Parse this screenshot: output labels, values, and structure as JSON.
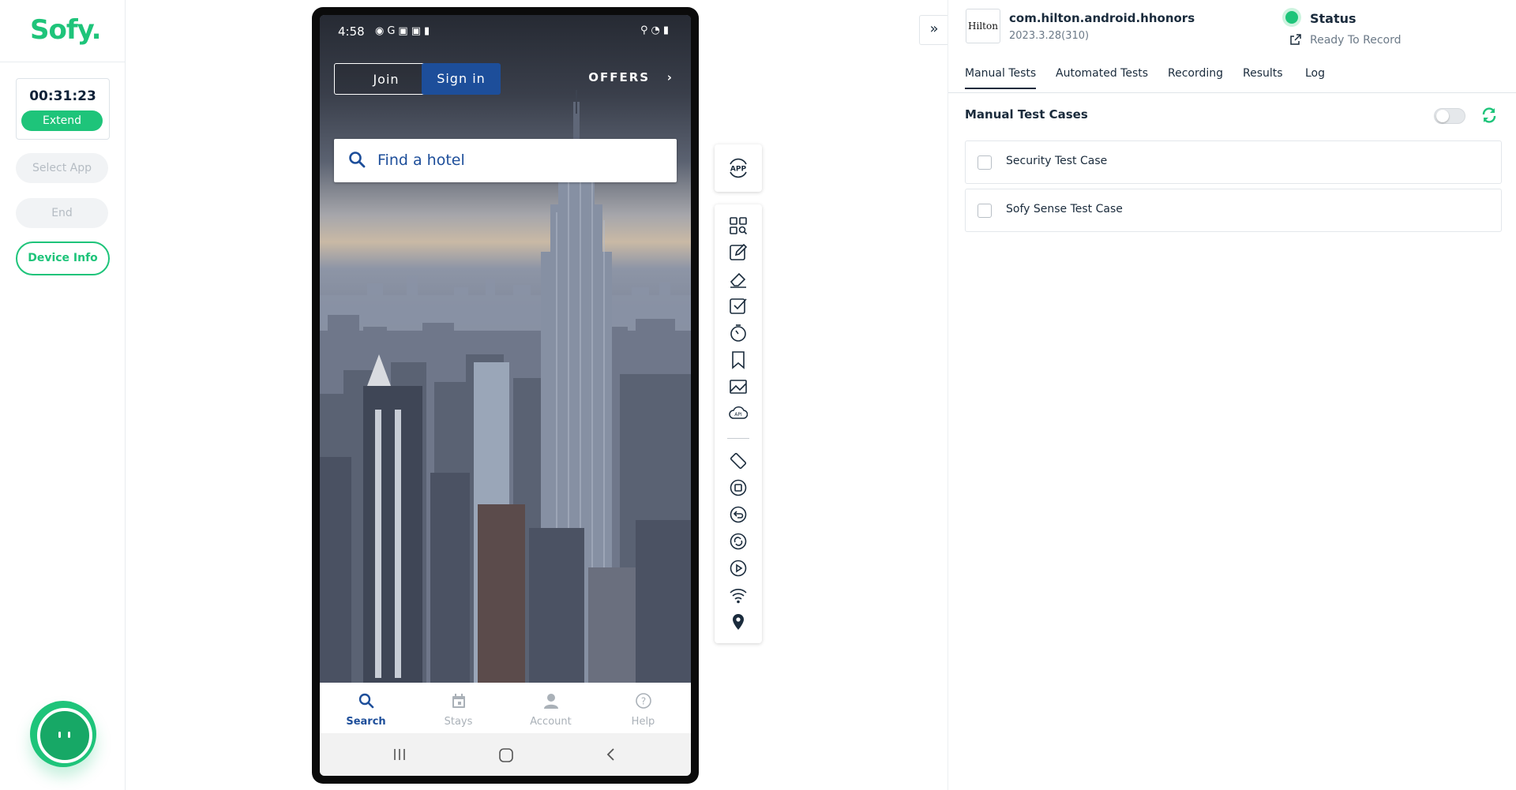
{
  "sidebar": {
    "logo": "Sofy.",
    "timer": "00:31:23",
    "extend_label": "Extend",
    "select_app_label": "Select App",
    "end_label": "End",
    "device_info_label": "Device Info"
  },
  "phone": {
    "status_time": "4:58",
    "join_label": "Join",
    "signin_label": "Sign in",
    "offers_label": "OFFERS",
    "search_placeholder": "Find a hotel",
    "nav": [
      {
        "label": "Search",
        "icon": "search-icon"
      },
      {
        "label": "Stays",
        "icon": "calendar-icon"
      },
      {
        "label": "Account",
        "icon": "person-icon"
      },
      {
        "label": "Help",
        "icon": "help-icon"
      }
    ],
    "brand_color": "#1d4e9a"
  },
  "toolbar": {
    "app_label": "APP"
  },
  "panel": {
    "app_logo_text": "Hilton",
    "app_package": "com.hilton.android.hhonors",
    "app_version": "2023.3.28(310)",
    "status_label": "Status",
    "status_text": "Ready To Record",
    "tabs": [
      {
        "label": "Manual Tests",
        "active": true
      },
      {
        "label": "Automated Tests",
        "active": false
      },
      {
        "label": "Recording",
        "active": false
      },
      {
        "label": "Results",
        "active": false
      },
      {
        "label": "Log",
        "active": false
      }
    ],
    "section_title": "Manual Test Cases",
    "test_cases": [
      {
        "label": "Security Test Case",
        "checked": false
      },
      {
        "label": "Sofy Sense Test Case",
        "checked": false
      }
    ]
  },
  "colors": {
    "accent": "#1ec47a",
    "text": "#1a2b3c"
  }
}
